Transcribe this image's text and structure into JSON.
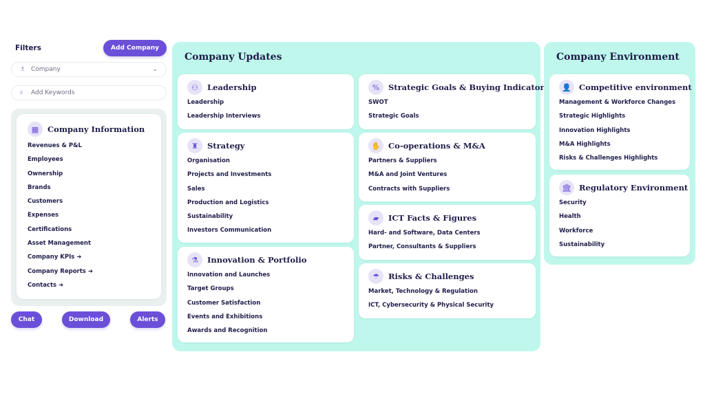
{
  "sidebar": {
    "filters_label": "Filters",
    "add_company_label": "Add Company",
    "company_select": {
      "value": "Company",
      "icon": "org-chart-icon"
    },
    "keywords_input": {
      "placeholder": "Add Keywords",
      "icon": "tag-icon"
    },
    "company_information": {
      "title": "Company Information",
      "icon": "building-icon",
      "items": [
        "Revenues & P&L",
        "Employees",
        "Ownership",
        "Brands",
        "Customers",
        "Expenses",
        "Certifications",
        "Asset Management",
        "Company KPIs ➜",
        "Company Reports ➜",
        "Contacts ➜"
      ]
    },
    "buttons": {
      "chat": "Chat",
      "download": "Download",
      "alerts": "Alerts"
    }
  },
  "updates": {
    "title": "Company Updates",
    "cards": {
      "leadership": {
        "title": "Leadership",
        "icon": "people-icon",
        "items": [
          "Leadership",
          "Leadership Interviews"
        ]
      },
      "strategy": {
        "title": "Strategy",
        "icon": "chess-icon",
        "items": [
          "Organisation",
          "Projects and Investments",
          "Sales",
          "Production and Logistics",
          "Sustainability",
          "Investors Communication"
        ]
      },
      "innovation": {
        "title": "Innovation & Portfolio",
        "icon": "flask-icon",
        "items": [
          "Innovation and Launches",
          "Target Groups",
          "Customer Satisfaction",
          "Events and Exhibitions",
          "Awards and Recognition"
        ]
      },
      "goals": {
        "title": "Strategic Goals & Buying Indicators",
        "icon": "percent-icon",
        "items": [
          "SWOT",
          "Strategic Goals"
        ]
      },
      "coop": {
        "title": "Co-operations & M&A",
        "icon": "handshake-icon",
        "items": [
          "Partners & Suppliers",
          "M&A and Joint Ventures",
          "Contracts with Suppliers"
        ]
      },
      "ict": {
        "title": "ICT Facts & Figures",
        "icon": "chat-icon",
        "items": [
          "Hard- and Software, Data Centers",
          "Partner, Consultants & Suppliers"
        ]
      },
      "risks": {
        "title": "Risks & Challenges",
        "icon": "umbrella-icon",
        "items": [
          "Market, Technology & Regulation",
          "ICT, Cybersecurity & Physical Security"
        ]
      }
    }
  },
  "environment": {
    "title": "Company Environment",
    "cards": {
      "competitive": {
        "title": "Competitive environment",
        "icon": "user-icon",
        "items": [
          "Management & Workforce Changes",
          "Strategic Highlights",
          "Innovation Highlights",
          "M&A Highlights",
          "Risks & Challenges Highlights"
        ]
      },
      "regulatory": {
        "title": "Regulatory Environment",
        "icon": "bank-icon",
        "items": [
          "Security",
          "Health",
          "Workforce",
          "Sustainability"
        ]
      }
    }
  },
  "colors": {
    "accent": "#6b4fd8",
    "panel": "#bff7ec",
    "text": "#1f1d4a"
  }
}
